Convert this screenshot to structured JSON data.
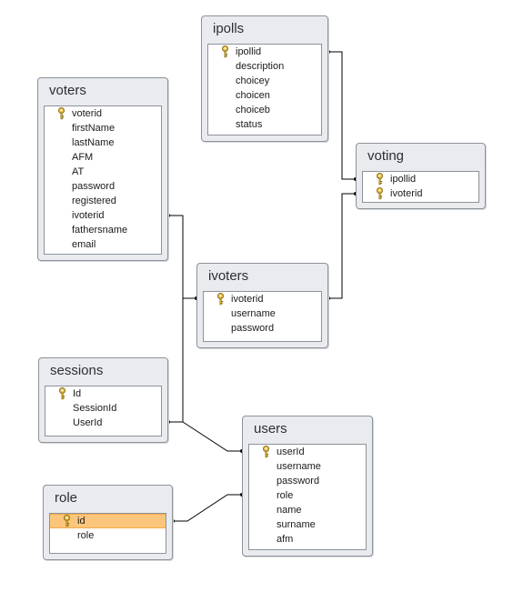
{
  "tables": {
    "ipolls": {
      "title": "ipolls",
      "fields": [
        {
          "name": "ipollid",
          "key": true
        },
        {
          "name": "description"
        },
        {
          "name": "choicey"
        },
        {
          "name": "choicen"
        },
        {
          "name": "choiceb"
        },
        {
          "name": "status"
        }
      ]
    },
    "voters": {
      "title": "voters",
      "fields": [
        {
          "name": "voterid",
          "key": true
        },
        {
          "name": "firstName"
        },
        {
          "name": "lastName"
        },
        {
          "name": "AFM"
        },
        {
          "name": "AT"
        },
        {
          "name": "password"
        },
        {
          "name": "registered"
        },
        {
          "name": "ivoterid"
        },
        {
          "name": "fathersname"
        },
        {
          "name": "email"
        }
      ]
    },
    "voting": {
      "title": "voting",
      "fields": [
        {
          "name": "ipollid",
          "key": true
        },
        {
          "name": "ivoterid",
          "key": true
        }
      ]
    },
    "ivoters": {
      "title": "ivoters",
      "fields": [
        {
          "name": "ivoterid",
          "key": true
        },
        {
          "name": "username"
        },
        {
          "name": "password"
        }
      ]
    },
    "sessions": {
      "title": "sessions",
      "fields": [
        {
          "name": "Id",
          "key": true
        },
        {
          "name": "SessionId"
        },
        {
          "name": "UserId"
        }
      ]
    },
    "users": {
      "title": "users",
      "fields": [
        {
          "name": "userId",
          "key": true
        },
        {
          "name": "username"
        },
        {
          "name": "password"
        },
        {
          "name": "role"
        },
        {
          "name": "name"
        },
        {
          "name": "surname"
        },
        {
          "name": "afm"
        }
      ]
    },
    "role": {
      "title": "role",
      "fields": [
        {
          "name": "id",
          "key": true,
          "selected": true
        },
        {
          "name": "role"
        }
      ]
    }
  },
  "colors": {
    "panel": "#e9ebee",
    "border": "#8d939a",
    "selected_row": "#fbc67c",
    "key_icon": "#c9a227",
    "line": "#000000"
  }
}
